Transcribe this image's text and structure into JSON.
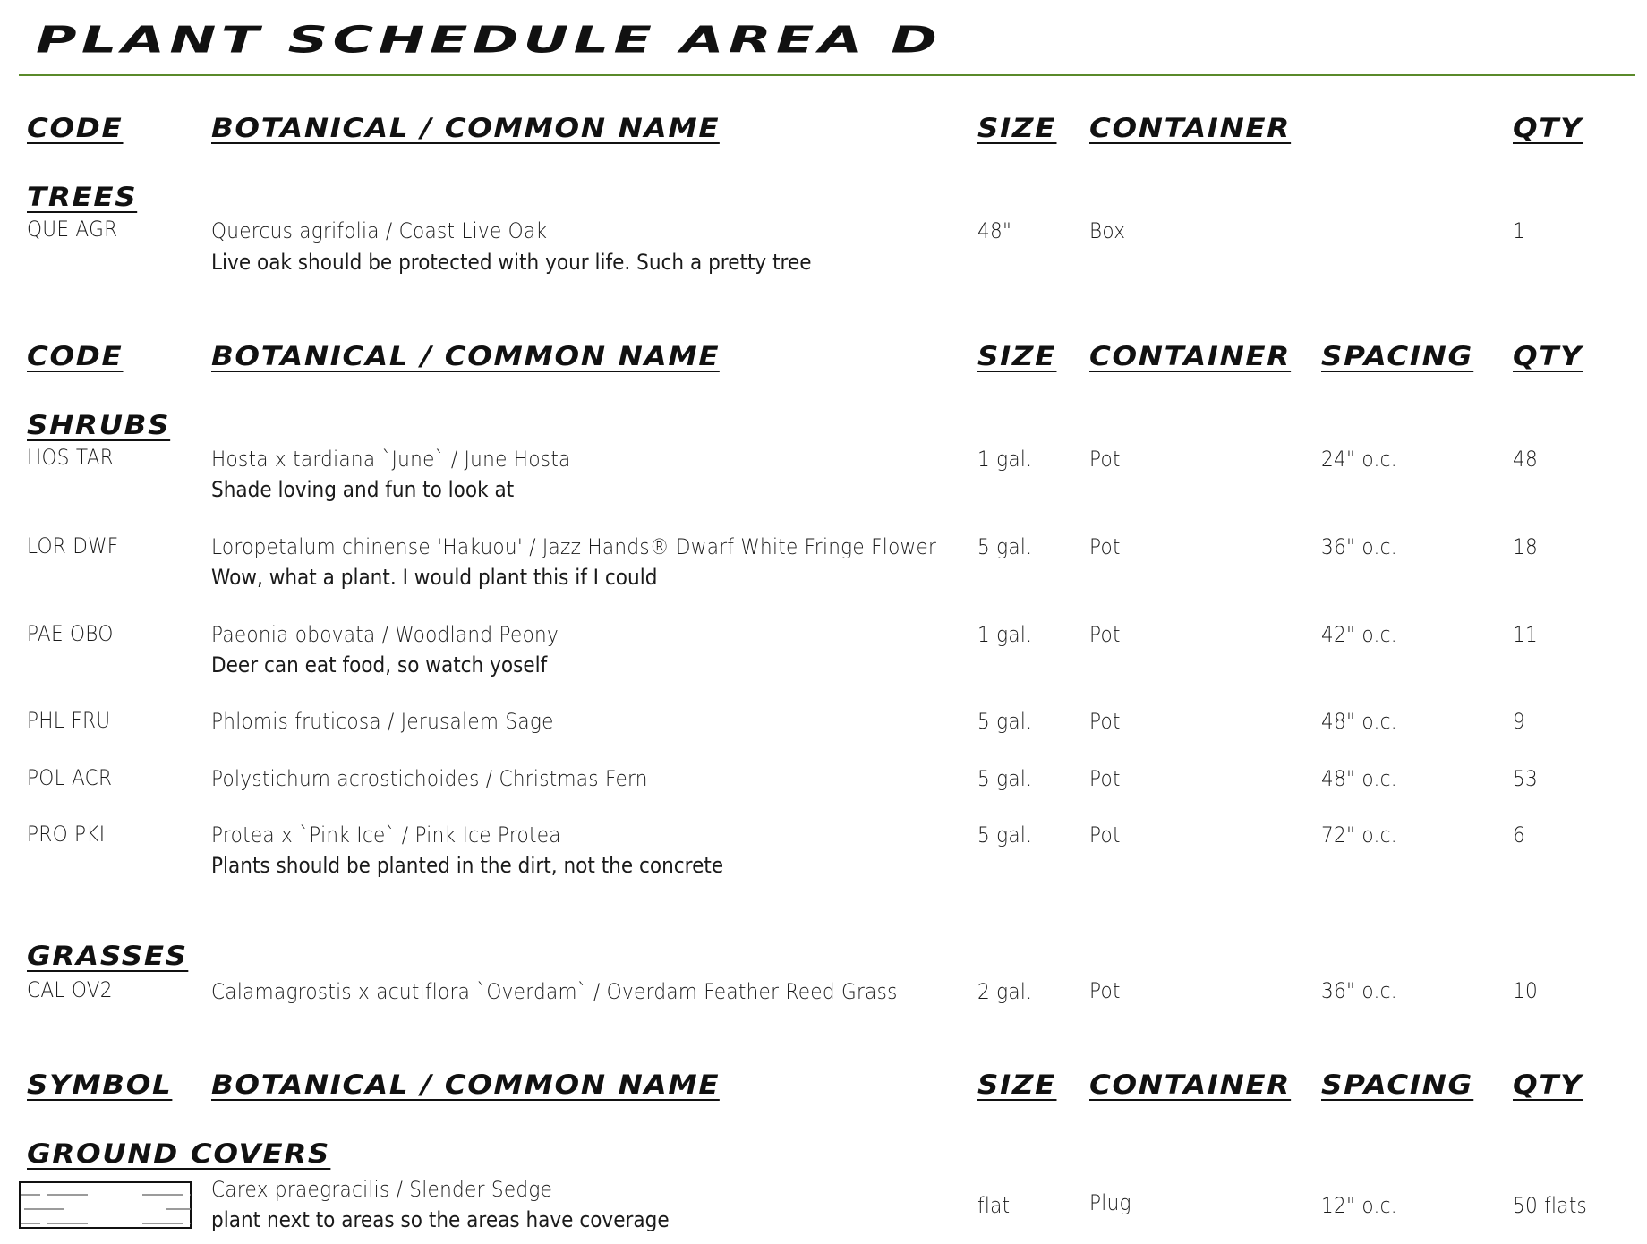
{
  "title": "Plant Schedule Area D",
  "colors": {
    "rule": "#5a8a2a",
    "text": "#111111"
  },
  "headers": {
    "code": "Code",
    "symbol": "Symbol",
    "name": "Botanical / Common Name",
    "size": "Size",
    "container": "Container",
    "spacing": "Spacing",
    "qty": "Qty"
  },
  "trees": {
    "category": "Trees",
    "rows": [
      {
        "code": "QUE AGR",
        "name": "Quercus agrifolia / Coast Live Oak",
        "note": "Live oak should be protected with your life. Such a pretty tree",
        "size": "48\"",
        "container": "Box",
        "qty": "1"
      }
    ]
  },
  "shrubs": {
    "category": "Shrubs",
    "rows": [
      {
        "code": "HOS TAR",
        "name": "Hosta x tardiana `June` / June Hosta",
        "note": "Shade loving and fun to look at",
        "size": "1 gal.",
        "container": "Pot",
        "spacing": "24\" o.c.",
        "qty": "48"
      },
      {
        "code": "LOR DWF",
        "name": "Loropetalum chinense 'Hakuou' / Jazz Hands® Dwarf White Fringe Flower",
        "note": "Wow, what a plant. I would plant this if I could",
        "size": "5 gal.",
        "container": "Pot",
        "spacing": "36\" o.c.",
        "qty": "18"
      },
      {
        "code": "PAE OBO",
        "name": "Paeonia obovata / Woodland Peony",
        "note": "Deer can eat food, so watch yoself",
        "size": "1 gal.",
        "container": "Pot",
        "spacing": "42\" o.c.",
        "qty": "11"
      },
      {
        "code": "PHL FRU",
        "name": "Phlomis fruticosa / Jerusalem Sage",
        "note": "",
        "size": "5 gal.",
        "container": "Pot",
        "spacing": "48\" o.c.",
        "qty": "9"
      },
      {
        "code": "POL ACR",
        "name": "Polystichum acrostichoides / Christmas Fern",
        "note": "",
        "size": "5 gal.",
        "container": "Pot",
        "spacing": "48\" o.c.",
        "qty": "53"
      },
      {
        "code": "PRO PKI",
        "name": "Protea x `Pink Ice` / Pink Ice Protea",
        "note": "Plants should be planted in the dirt, not the concrete",
        "size": "5 gal.",
        "container": "Pot",
        "spacing": "72\" o.c.",
        "qty": "6"
      }
    ]
  },
  "grasses": {
    "category": "Grasses",
    "rows": [
      {
        "code": "CAL OV2",
        "name": "Calamagrostis x acutiflora `Overdam` / Overdam Feather Reed Grass",
        "size": "2 gal.",
        "container": "Pot",
        "spacing": "36\" o.c.",
        "qty": "10"
      }
    ]
  },
  "ground_covers": {
    "category": "Ground Covers",
    "rows": [
      {
        "symbol_icon": "hatch-pattern-symbol",
        "name": "Carex praegracilis / Slender Sedge",
        "note": "plant next to areas so the areas have coverage",
        "size": "flat",
        "container": "Plug",
        "spacing": "12\" o.c.",
        "qty": "50 flats"
      }
    ]
  }
}
